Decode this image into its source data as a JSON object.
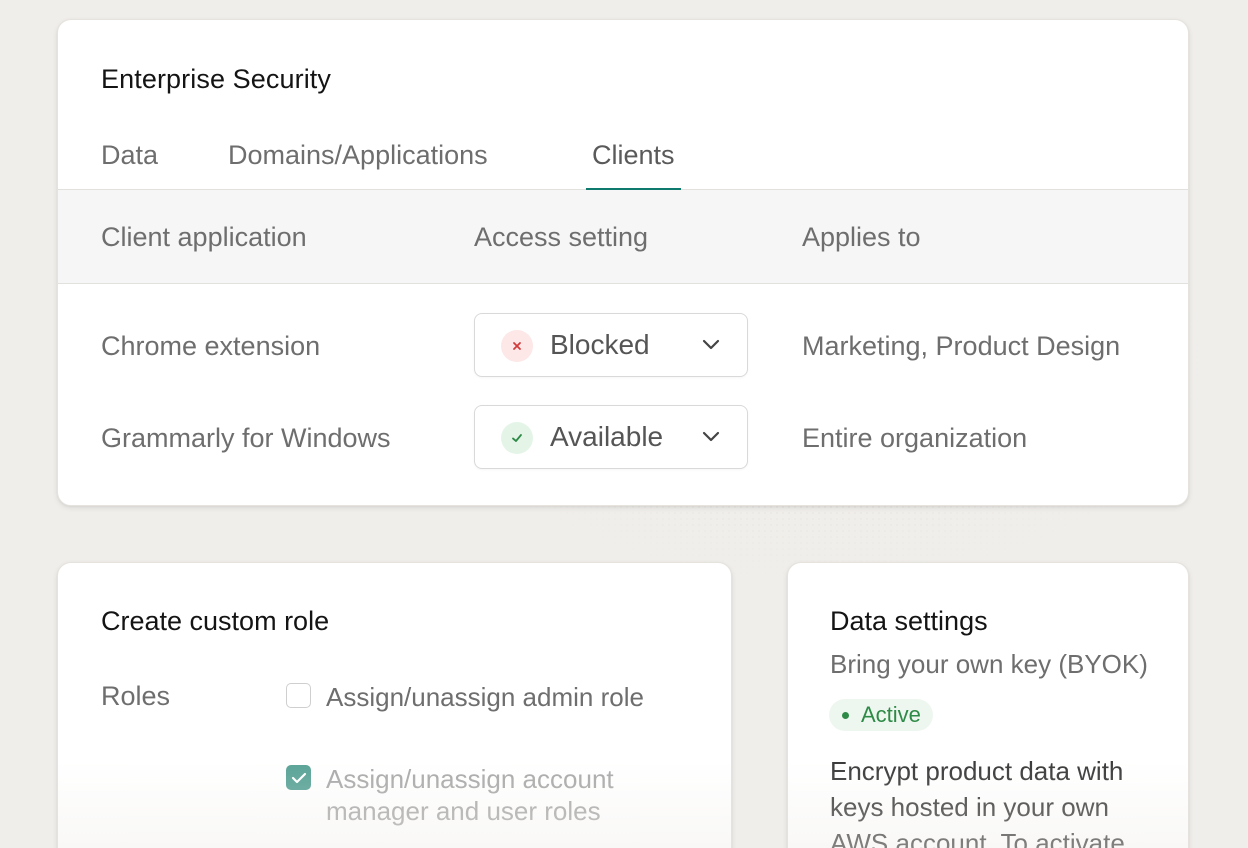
{
  "security": {
    "title": "Enterprise Security",
    "tabs": [
      {
        "label": "Data",
        "active": false
      },
      {
        "label": "Domains/Applications",
        "active": false
      },
      {
        "label": "Clients",
        "active": true
      }
    ],
    "table": {
      "headers": [
        "Client application",
        "Access setting",
        "Applies to"
      ],
      "rows": [
        {
          "client": "Chrome extension",
          "access": "Blocked",
          "access_icon": "x-icon",
          "applies_to": "Marketing, Product Design"
        },
        {
          "client": "Grammarly for Windows",
          "access": "Available",
          "access_icon": "check-icon",
          "applies_to": "Entire organization"
        }
      ]
    }
  },
  "custom_role": {
    "title": "Create custom role",
    "roles_label": "Roles",
    "options": [
      {
        "label": "Assign/unassign admin role",
        "checked": false
      },
      {
        "label": "Assign/unassign account manager and user roles",
        "checked": true
      }
    ]
  },
  "data_settings": {
    "title": "Data settings",
    "subtitle": "Bring your own key (BYOK)",
    "status": "Active",
    "description": "Encrypt product data with keys hosted in your own AWS account. To activate"
  },
  "colors": {
    "accent": "#0e7a6e",
    "checkbox_checked": "#5aa397",
    "blocked": "#d23b3b",
    "available": "#2e8a47"
  }
}
